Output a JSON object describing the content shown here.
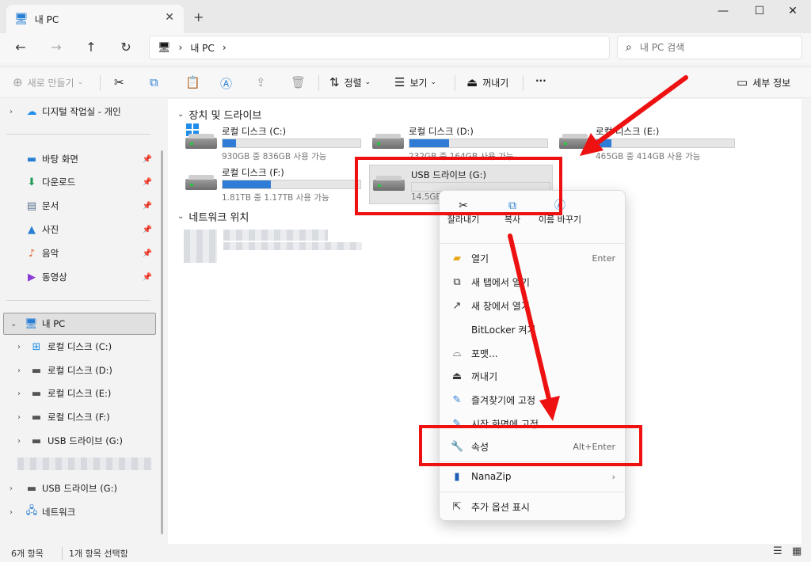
{
  "window": {
    "tab_title": "내 PC",
    "tab_close": "✕",
    "new_tab": "+",
    "minimize": "—",
    "maximize": "☐",
    "close": "✕"
  },
  "nav": {
    "back": "←",
    "forward": "→",
    "up": "↑",
    "refresh": "↻",
    "crumb_sep1": "›",
    "crumb": "내 PC",
    "crumb_sep2": "›"
  },
  "search": {
    "placeholder": "내 PC 검색"
  },
  "toolbar": {
    "new_label": "새로 만들기",
    "sort_label": "정렬",
    "view_label": "보기",
    "eject_label": "꺼내기",
    "more_label": "···",
    "details_label": "세부 정보"
  },
  "sidebar": {
    "onedrive": "디지털 작업실 - 개인",
    "quick": [
      {
        "label": "바탕 화면"
      },
      {
        "label": "다운로드"
      },
      {
        "label": "문서"
      },
      {
        "label": "사진"
      },
      {
        "label": "음악"
      },
      {
        "label": "동영상"
      }
    ],
    "this_pc": "내 PC",
    "drives": [
      {
        "label": "로컬 디스크 (C:)"
      },
      {
        "label": "로컬 디스크 (D:)"
      },
      {
        "label": "로컬 디스크 (E:)"
      },
      {
        "label": "로컬 디스크 (F:)"
      },
      {
        "label": "USB 드라이브 (G:)"
      }
    ],
    "usb_root": "USB 드라이브 (G:)",
    "network": "네트워크"
  },
  "content": {
    "devices_header": "장치 및 드라이브",
    "network_header": "네트워크 위치",
    "drives": [
      {
        "name": "로컬 디스크 (C:)",
        "free": "930GB 중 836GB 사용 가능",
        "used_fraction": 0.1
      },
      {
        "name": "로컬 디스크 (D:)",
        "free": "232GB 중 164GB 사용 가능",
        "used_fraction": 0.29
      },
      {
        "name": "로컬 디스크 (E:)",
        "free": "465GB 중 414GB 사용 가능",
        "used_fraction": 0.11
      },
      {
        "name": "로컬 디스크 (F:)",
        "free": "1.81TB 중 1.17TB 사용 가능",
        "used_fraction": 0.35
      },
      {
        "name": "USB 드라이브 (G:)",
        "free": "14.5GB",
        "used_fraction": 0.0
      }
    ]
  },
  "context_menu": {
    "quick": [
      {
        "label": "잘라내기"
      },
      {
        "label": "복사"
      },
      {
        "label": "이름 바꾸기"
      }
    ],
    "items": [
      {
        "label": "열기",
        "key": "Enter"
      },
      {
        "label": "새 탭에서 열기",
        "key": ""
      },
      {
        "label": "새 창에서 열기",
        "key": ""
      },
      {
        "label": "BitLocker 켜기",
        "key": ""
      },
      {
        "label": "포맷...",
        "key": ""
      },
      {
        "label": "꺼내기",
        "key": ""
      },
      {
        "label": "즐겨찾기에 고정",
        "key": ""
      },
      {
        "label": "시작 화면에 고정",
        "key": ""
      },
      {
        "label": "속성",
        "key": "Alt+Enter"
      },
      {
        "label": "NanaZip",
        "key": "›"
      },
      {
        "label": "추가 옵션 표시",
        "key": ""
      }
    ]
  },
  "status": {
    "count": "6개 항목",
    "selected": "1개 항목 선택함"
  },
  "annotation_color": "#ee1111"
}
